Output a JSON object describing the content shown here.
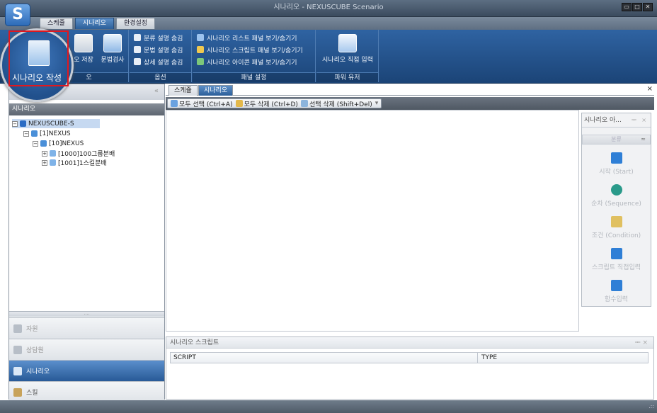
{
  "window": {
    "title": "시나리오 - NEXUSCUBE Scenario",
    "logo_letter": "S",
    "controls": [
      "▭",
      "□",
      "✕"
    ]
  },
  "menu_tabs": [
    {
      "label": "스케쥴",
      "active": false
    },
    {
      "label": "시나리오",
      "active": true
    },
    {
      "label": "환경설정",
      "active": false
    }
  ],
  "ribbon": {
    "scenario_group": {
      "label": "오",
      "buttons": [
        {
          "label": "오 저장"
        },
        {
          "label": "문법검사"
        }
      ]
    },
    "options_group": {
      "label": "옵션",
      "items": [
        {
          "label": "분류 설명 숨김"
        },
        {
          "label": "문법 설명 숨김"
        },
        {
          "label": "상세 설명 숨김"
        }
      ]
    },
    "panel_group": {
      "label": "패널 설정",
      "items": [
        {
          "label": "시나리오 리스트 패널 보기/숨기기"
        },
        {
          "label": "시나리오 스크립트 패널 보기/숨기기"
        },
        {
          "label": "시나리오 아이콘 패널 보기/숨기기"
        }
      ]
    },
    "power_group": {
      "label": "파워 유저",
      "button": "시나리오 직접 입력"
    },
    "magnified_button": "시나리오 작성"
  },
  "left_panel": {
    "collapse": "«",
    "title": "시나리오",
    "tree": [
      {
        "label": "NEXUSCUBE-S",
        "level": 0,
        "toggle": "−"
      },
      {
        "label": "[1]NEXUS",
        "level": 1,
        "toggle": "−"
      },
      {
        "label": "[10]NEXUS",
        "level": 2,
        "toggle": "−"
      },
      {
        "label": "[1000]100그룹분배",
        "level": 3,
        "toggle": "+"
      },
      {
        "label": "[1001]1스킬분배",
        "level": 3,
        "toggle": "+"
      }
    ],
    "divider": "....",
    "nav": [
      {
        "label": "자원",
        "active": false
      },
      {
        "label": "상담원",
        "active": false
      },
      {
        "label": "시나리오",
        "active": true
      },
      {
        "label": "스킬",
        "active": false
      }
    ]
  },
  "doc_tabs": [
    {
      "label": "스케쥴",
      "active": false
    },
    {
      "label": "시나리오",
      "active": true
    }
  ],
  "doc_close": "×",
  "toolbar": {
    "select_all": "모두 선택 (Ctrl+A)",
    "delete_all": "모두 삭제 (Ctrl+D)",
    "delete_selected": "선택 삭제 (Shift+Del)",
    "more": "▾"
  },
  "palette": {
    "title": "시나리오 아...",
    "pin": "ᆍ",
    "close": "×",
    "sub_header": "분류",
    "sub_collapse": "≈",
    "items": [
      {
        "label": "시작 (Start)",
        "color": "#2f7fd6"
      },
      {
        "label": "순차 (Sequence)",
        "color": "#2a9a8a"
      },
      {
        "label": "조건 (Condition)",
        "color": "#e0c060"
      },
      {
        "label": "스크립트 직접입력",
        "color": "#2f7fd6"
      },
      {
        "label": "함수입력",
        "color": "#2f7fd6"
      }
    ]
  },
  "script_panel": {
    "title": "시나리오 스크립트",
    "controls": "ᆍ  ×",
    "columns": [
      "SCRIPT",
      "TYPE"
    ]
  },
  "statusbar": {
    "grip": ".::"
  }
}
